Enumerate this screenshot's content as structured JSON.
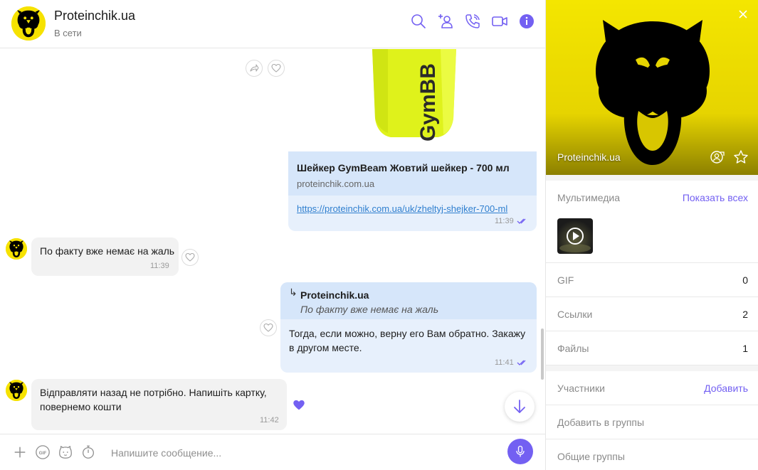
{
  "header": {
    "name": "Proteinchik.ua",
    "status": "В сети"
  },
  "messages": {
    "link_card": {
      "preview_text": "GymBB",
      "title": "Шейкер GymBeam Жовтий шейкер - 700 мл",
      "domain": "proteinchik.com.ua",
      "url": "https://proteinchik.com.ua/uk/zheltyj-shejker-700-ml",
      "time": "11:39"
    },
    "in1": {
      "text": "По факту вже немає на жаль",
      "time": "11:39"
    },
    "out1": {
      "reply_author": "Proteinchik.ua",
      "reply_text": "По факту вже немає на жаль",
      "text_line1": "Тогда, если можно, верну его Вам обратно.  Закажу",
      "text_line2": "в другом месте.",
      "time": "11:41"
    },
    "in2": {
      "text_line1": "Відправляти назад не потрібно. Напишіть картку,",
      "text_line2": "повернемо кошти",
      "time": "11:42"
    }
  },
  "composer": {
    "placeholder": "Напишите сообщение...",
    "gif_label": "GIF"
  },
  "panel": {
    "name": "Proteinchik.ua",
    "multimedia_label": "Мультимедиа",
    "show_all": "Показать всех",
    "gif_label": "GIF",
    "gif_count": "0",
    "links_label": "Ссылки",
    "links_count": "2",
    "files_label": "Файлы",
    "files_count": "1",
    "participants_label": "Участники",
    "add_label": "Добавить",
    "add_to_groups": "Добавить в группы",
    "common_groups": "Общие группы"
  },
  "colors": {
    "accent": "#7360f2",
    "brand_yellow": "#f6e200",
    "bubble_out": "#e7f0fc",
    "bubble_in": "#f2f2f2",
    "link": "#2f7fcf"
  }
}
